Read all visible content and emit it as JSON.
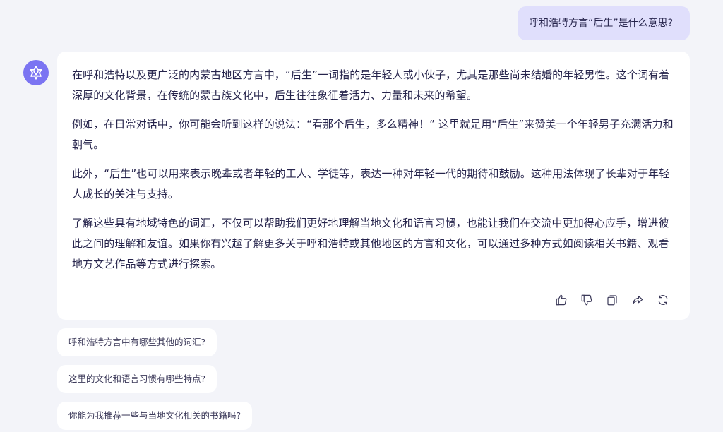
{
  "conversation": {
    "user_message": "呼和浩特方言“后生”是什么意思?",
    "answer_paragraphs": [
      "在呼和浩特以及更广泛的内蒙古地区方言中，“后生”一词指的是年轻人或小伙子，尤其是那些尚未结婚的年轻男性。这个词有着深厚的文化背景，在传统的蒙古族文化中，后生往往象征着活力、力量和未来的希望。",
      "例如，在日常对话中，你可能会听到这样的说法：“看那个后生，多么精神！” 这里就是用“后生”来赞美一个年轻男子充满活力和朝气。",
      "此外，“后生”也可以用来表示晚辈或者年轻的工人、学徒等，表达一种对年轻一代的期待和鼓励。这种用法体现了长辈对于年轻人成长的关注与支持。",
      "了解这些具有地域特色的词汇，不仅可以帮助我们更好地理解当地文化和语言习惯，也能让我们在交流中更加得心应手，增进彼此之间的理解和友谊。如果你有兴趣了解更多关于呼和浩特或其他地区的方言和文化，可以通过多种方式如阅读相关书籍、观看地方文艺作品等方式进行探索。"
    ],
    "actions": [
      "thumbs-up-icon",
      "thumbs-down-icon",
      "copy-icon",
      "share-icon",
      "regenerate-icon"
    ]
  },
  "suggestions": [
    "呼和浩特方言中有哪些其他的词汇?",
    "这里的文化和语言习惯有哪些特点?",
    "你能为我推荐一些与当地文化相关的书籍吗?"
  ],
  "colors": {
    "background": "#f3f4f9",
    "user_bubble": "#e0dffc",
    "avatar": "#7b74f2",
    "card": "#ffffff",
    "text": "#26244c"
  }
}
